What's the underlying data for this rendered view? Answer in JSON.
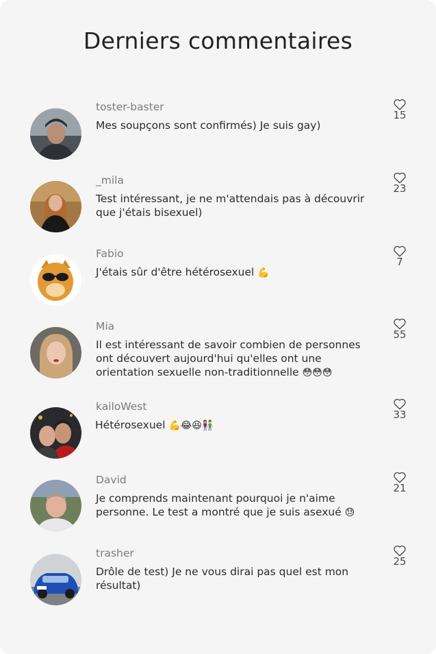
{
  "header": {
    "title": "Derniers commentaires"
  },
  "comments": [
    {
      "username": "toster-baster",
      "text": "Mes soupçons sont confirmés) Je suis gay)",
      "likes": "15"
    },
    {
      "username": "_mila",
      "text": "Test intéressant, je ne m'attendais pas à découvrir que j'étais bisexuel)",
      "likes": "23"
    },
    {
      "username": "Fabio",
      "text": "J'étais sûr d'être hétérosexuel",
      "emoji": "💪",
      "likes": "7"
    },
    {
      "username": "Mia",
      "text": "Il est intéressant de savoir combien de personnes ont découvert aujourd'hui qu'elles ont une orientation sexuelle non-traditionnelle",
      "emoji": "😳😳😳",
      "likes": "55"
    },
    {
      "username": "kailoWest",
      "text": "Hétérosexuel",
      "emoji": "💪😂😆👫",
      "likes": "33"
    },
    {
      "username": "David",
      "text": "Je comprends maintenant pourquoi je n'aime personne. Le test a montré que je suis asexué",
      "emoji": "😓",
      "likes": "21"
    },
    {
      "username": "trasher",
      "text": "Drôle de test) Je ne vous dirai pas quel est mon résultat)",
      "likes": "25"
    }
  ],
  "icons": {
    "like": "heart-outline-icon"
  },
  "colors": {
    "background": "#f5f5f5",
    "title": "#222222",
    "username": "#7b7b7b",
    "text": "#2b2b2b"
  }
}
